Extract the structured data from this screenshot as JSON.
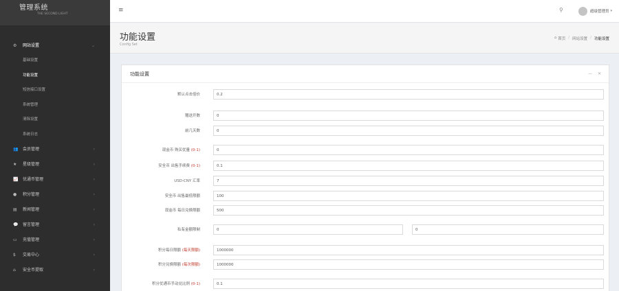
{
  "brand": {
    "title": "管理系统",
    "subtitle": "THE SECOND LIGHT"
  },
  "menu": {
    "open_group": {
      "icon": "gears-icon",
      "label": "网站设置"
    },
    "submenu": [
      "基础设置",
      "功能设置",
      "短信接口设置",
      "系统管理",
      "清除设置",
      "系统日志"
    ],
    "items": [
      {
        "icon": "users-icon",
        "label": "会员管理"
      },
      {
        "icon": "star-icon",
        "label": "星级管理"
      },
      {
        "icon": "chart-icon",
        "label": "优通币管理"
      },
      {
        "icon": "coins-icon",
        "label": "积分管理"
      },
      {
        "icon": "news-icon",
        "label": "新闻管理"
      },
      {
        "icon": "chat-icon",
        "label": "留言管理"
      },
      {
        "icon": "card-icon",
        "label": "充值管理"
      },
      {
        "icon": "dollar-icon",
        "label": "交易中心"
      },
      {
        "icon": "bank-icon",
        "label": "安全币提取"
      }
    ]
  },
  "topbar": {
    "user_name": "超级管理员"
  },
  "page": {
    "title": "功能设置",
    "subtitle": "Config Set",
    "breadcrumb": [
      "首页",
      "网站设置",
      "功能设置"
    ]
  },
  "panel": {
    "title": "功能设置",
    "tools": "— ✕",
    "fields": [
      {
        "label": "默认点击倍价",
        "hint": "",
        "value": "0.2"
      },
      {
        "label": "赠送开数",
        "hint": "",
        "value": "0"
      },
      {
        "label": "前几天数",
        "hint": "",
        "value": "0"
      },
      {
        "label": "现金币 购买优量",
        "hint": "(0-1)",
        "value": "0"
      },
      {
        "label": "安全币 出售手续费",
        "hint": "(0-1)",
        "value": "0.1"
      },
      {
        "label": "USD-CNY 汇率",
        "hint": "",
        "value": "7"
      },
      {
        "label": "安全币 出售最低限额",
        "hint": "",
        "value": "100"
      },
      {
        "label": "现金币 每日兑换限额",
        "hint": "",
        "value": "500"
      },
      {
        "label": "私有金额限制",
        "hint": "",
        "value": "0",
        "value2": "0"
      },
      {
        "label": "积分每日限额",
        "hint": "(每天限额)",
        "value": "1000000"
      },
      {
        "label": "积分兑换限额",
        "hint": "(每次限额)",
        "value": "1000000"
      },
      {
        "label": "积分优通币手动兑比例",
        "hint": "(0-1)",
        "value": "0.1"
      }
    ]
  }
}
